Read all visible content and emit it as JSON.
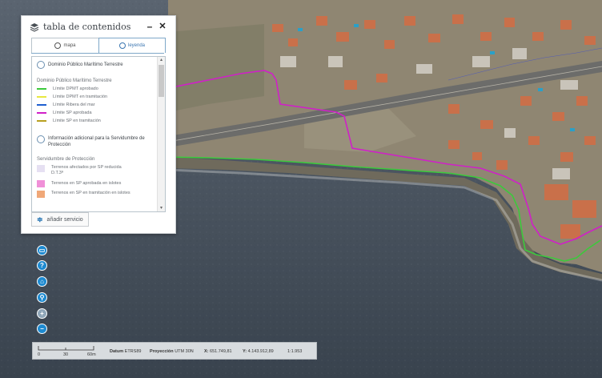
{
  "panel": {
    "title": "tabla de contenidos",
    "minimize": "–",
    "close": "✕",
    "tabs": [
      {
        "label": "mapa",
        "active": false
      },
      {
        "label": "leyenda",
        "active": true
      }
    ],
    "sections": [
      {
        "title": "Dominio Público Marítimo Terrestre",
        "subtitle": "Dominio Público Marítimo Terrestre",
        "items": [
          {
            "label": "Límite DPMT aprobado",
            "color": "#3cc93c"
          },
          {
            "label": "Límite DPMT en tramitación",
            "color": "#e8e840"
          },
          {
            "label": "Límite Ribera del mar",
            "color": "#1f5fd0"
          },
          {
            "label": "Límite SP aprobada",
            "color": "#d020c8"
          },
          {
            "label": "Límite SP en tramitación",
            "color": "#b8a020"
          }
        ]
      },
      {
        "title": "Información adicional para la Servidumbre de Protección",
        "subtitle": "Servidumbre de Protección",
        "items": [
          {
            "label": "Terrenos afectados por SP reducida D.T.3ª",
            "color": "#e6e0f2"
          },
          {
            "label": "Terrenos en SP aprobada en islotes",
            "color": "#f090d8"
          },
          {
            "label": "Terrenos en SP en tramitación en islotes",
            "color": "#f0a878"
          }
        ]
      }
    ],
    "add_service": "añadir servicio"
  },
  "tools": [
    {
      "icon": "print-icon",
      "glyph": "▭"
    },
    {
      "icon": "help-icon",
      "glyph": "?"
    },
    {
      "icon": "home-icon",
      "glyph": "⌂"
    },
    {
      "icon": "search-icon",
      "glyph": "⚲"
    },
    {
      "icon": "zoom-in-icon",
      "glyph": "+"
    },
    {
      "icon": "zoom-out-icon",
      "glyph": "−"
    }
  ],
  "status": {
    "scale_ticks": [
      "0",
      "30",
      "60m"
    ],
    "datum_label": "Datum",
    "datum": "ETRS89",
    "projection_label": "Proyección",
    "projection": "UTM 30N",
    "x_label": "X:",
    "x": "651.749,81",
    "y_label": "Y:",
    "y": "4.143.912,89",
    "scale": "1:1.953"
  },
  "map": {
    "sea_color": "#4a5560",
    "land_color": "#8f8672",
    "line_dpmt_color": "#3cc93c",
    "line_sp_color": "#d020c8"
  }
}
